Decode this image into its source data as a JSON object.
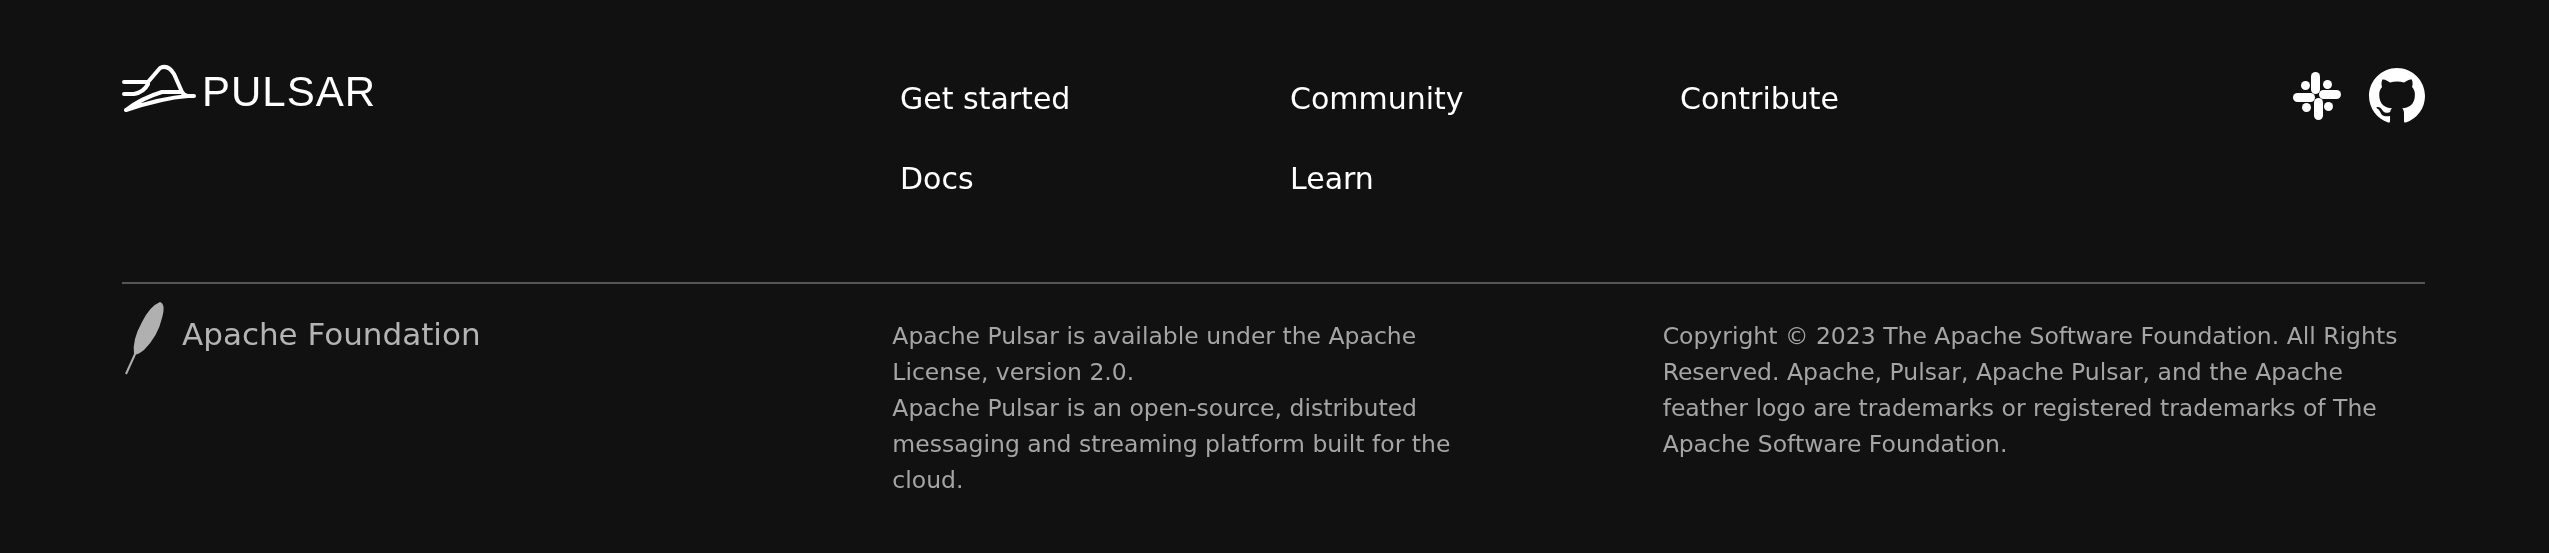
{
  "logo": {
    "wordmark": "PULSAR"
  },
  "nav_links": [
    {
      "label": "Get started"
    },
    {
      "label": "Community"
    },
    {
      "label": "Contribute"
    },
    {
      "label": "Docs"
    },
    {
      "label": "Learn"
    }
  ],
  "foundation": {
    "name": "Apache Foundation"
  },
  "about_lines": [
    "Apache Pulsar is available under the Apache License, version 2.0.",
    "Apache Pulsar is an open-source, distributed messaging and streaming platform built for the cloud."
  ],
  "copyright": "Copyright © 2023 The Apache Software Foundation. All Rights Reserved. Apache, Pulsar, Apache Pulsar, and the Apache feather logo are trademarks or registered trademarks of The Apache Software Foundation."
}
